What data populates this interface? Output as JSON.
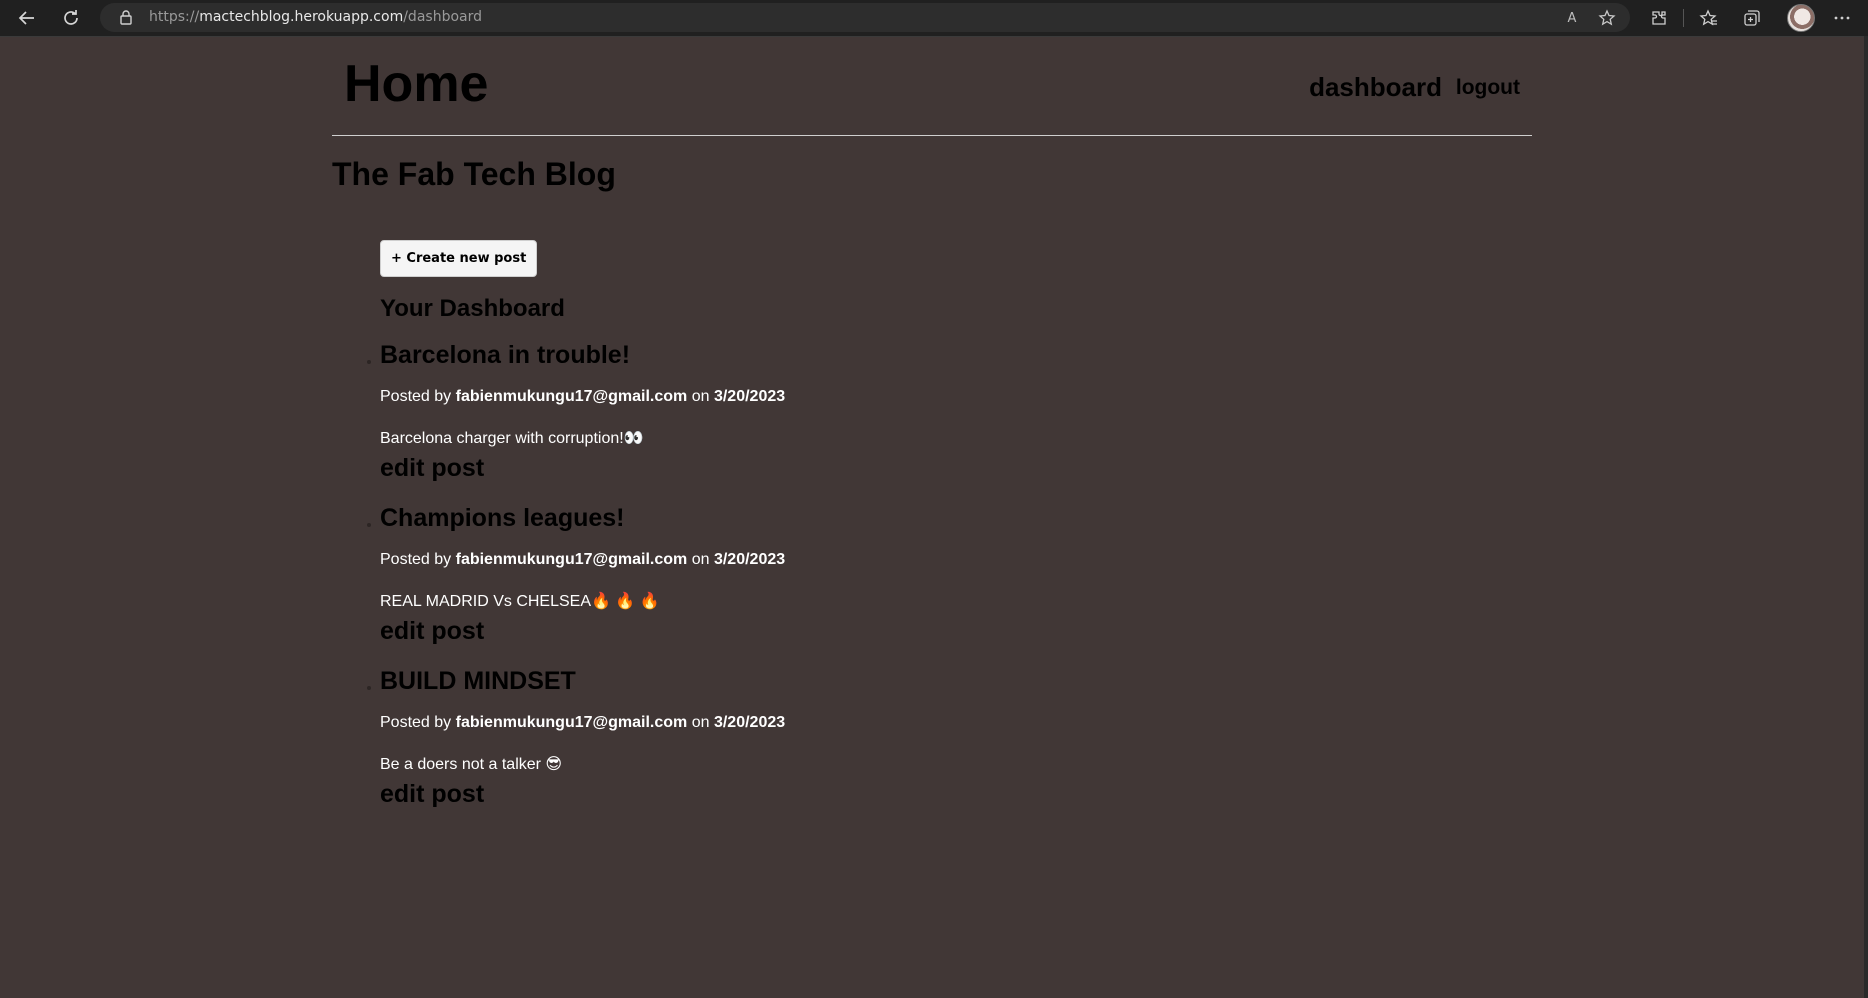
{
  "browser": {
    "url_scheme": "https://",
    "url_host": "mactechblog.herokuapp.com",
    "url_path": "/dashboard",
    "read_aloud_icon": "A",
    "icons": [
      "back-icon",
      "refresh-icon",
      "lock-icon",
      "read-aloud-icon",
      "add-favorite-icon",
      "extensions-icon",
      "favorites-icon",
      "collections-icon",
      "profile-avatar",
      "more-icon"
    ]
  },
  "header": {
    "title": "Home",
    "nav": {
      "dashboard": "dashboard",
      "logout": "logout"
    }
  },
  "site_title": "The Fab Tech Blog",
  "dashboard": {
    "create_button": "+ Create new post",
    "heading": "Your Dashboard",
    "posted_by_label": "Posted by",
    "on_label": "on",
    "edit_label": "edit post",
    "posts": [
      {
        "title": "Barcelona in trouble!",
        "author": "fabienmukungu17@gmail.com",
        "date": "3/20/2023",
        "body": "Barcelona charger with corruption!👀"
      },
      {
        "title": "Champions leagues!",
        "author": "fabienmukungu17@gmail.com",
        "date": "3/20/2023",
        "body": "REAL MADRID Vs CHELSEA🔥 🔥 🔥"
      },
      {
        "title": "BUILD MINDSET",
        "author": "fabienmukungu17@gmail.com",
        "date": "3/20/2023",
        "body": "Be a doers not a talker 😎"
      }
    ]
  },
  "colors": {
    "page_background": "#413736",
    "chrome_background": "#202020",
    "button_background": "#f5f5f5"
  }
}
